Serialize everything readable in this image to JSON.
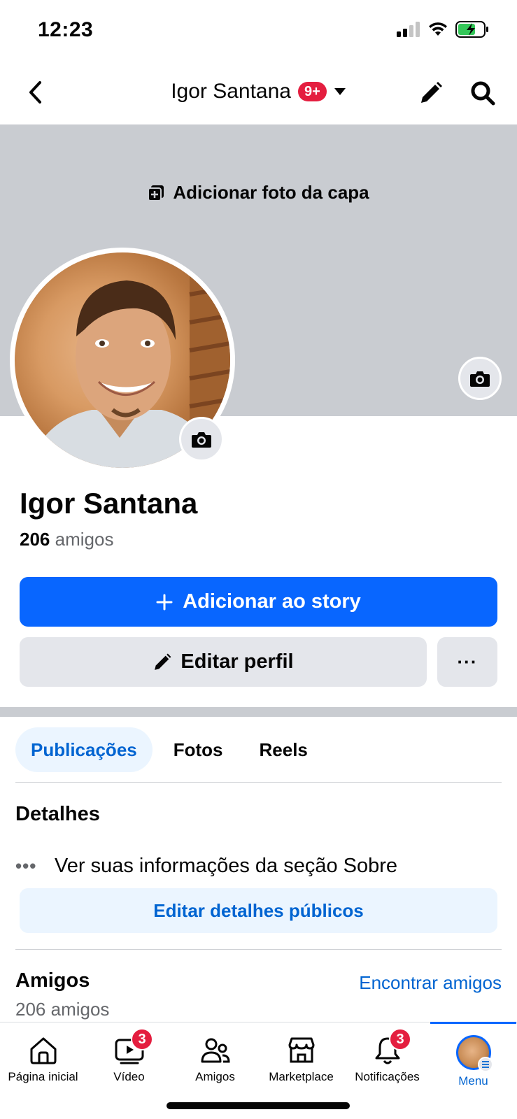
{
  "status_bar": {
    "time": "12:23"
  },
  "header": {
    "title": "Igor Santana",
    "notification_badge": "9+",
    "icons": [
      "back-icon",
      "caret-down-icon",
      "pencil-icon",
      "search-icon"
    ]
  },
  "cover": {
    "add_cover_label": "Adicionar foto da capa"
  },
  "profile": {
    "name": "Igor Santana",
    "friends_count": "206",
    "friends_word": "amigos"
  },
  "actions": {
    "add_story_label": "Adicionar ao story",
    "edit_profile_label": "Editar perfil",
    "more_label": "···"
  },
  "tabs": [
    {
      "label": "Publicações",
      "active": true
    },
    {
      "label": "Fotos",
      "active": false
    },
    {
      "label": "Reels",
      "active": false
    }
  ],
  "details": {
    "title": "Detalhes",
    "about_text": "Ver suas informações da seção Sobre",
    "edit_button": "Editar detalhes públicos"
  },
  "friends_section": {
    "title": "Amigos",
    "find_link": "Encontrar amigos",
    "count_text": "206 amigos"
  },
  "bottom_nav": [
    {
      "label": "Página inicial",
      "icon": "home-icon"
    },
    {
      "label": "Vídeo",
      "icon": "video-icon",
      "badge": "3"
    },
    {
      "label": "Amigos",
      "icon": "friends-icon"
    },
    {
      "label": "Marketplace",
      "icon": "marketplace-icon"
    },
    {
      "label": "Notificações",
      "icon": "bell-icon",
      "badge": "3"
    },
    {
      "label": "Menu",
      "icon": "avatar",
      "active": true
    }
  ],
  "colors": {
    "primary": "#0866ff",
    "link": "#0064d1",
    "badge": "#e41e3f",
    "cover": "#c9ccd1",
    "button_gray": "#e4e6eb"
  }
}
